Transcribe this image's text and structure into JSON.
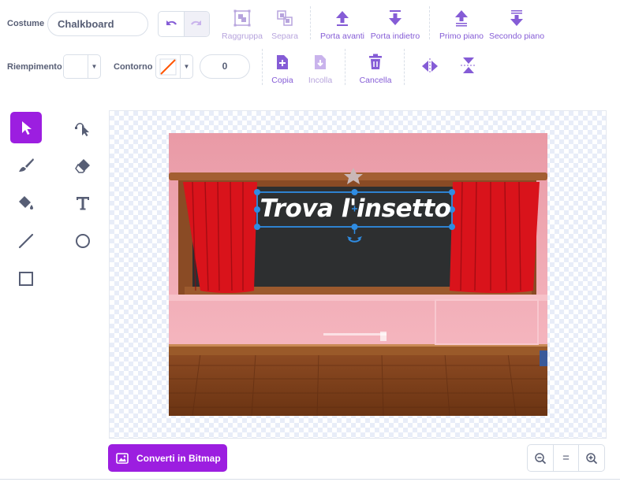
{
  "costume": {
    "label": "Costume",
    "name": "Chalkboard"
  },
  "toolbar": {
    "group": "Raggruppa",
    "ungroup": "Separa",
    "forward": "Porta avanti",
    "backward": "Porta indietro",
    "front": "Primo piano",
    "back": "Secondo piano",
    "copy": "Copia",
    "paste": "Incolla",
    "delete": "Cancella"
  },
  "fill": {
    "label": "Riempimento",
    "color": "#ffffff"
  },
  "outline": {
    "label": "Contorno",
    "width": "0"
  },
  "tools": [
    {
      "name": "select-tool-icon",
      "active": true
    },
    {
      "name": "reshape-tool-icon",
      "active": false
    },
    {
      "name": "brush-tool-icon",
      "active": false
    },
    {
      "name": "eraser-tool-icon",
      "active": false
    },
    {
      "name": "fill-tool-icon",
      "active": false
    },
    {
      "name": "text-tool-icon",
      "active": false
    },
    {
      "name": "line-tool-icon",
      "active": false
    },
    {
      "name": "circle-tool-icon",
      "active": false
    },
    {
      "name": "rectangle-tool-icon",
      "active": false
    }
  ],
  "canvas": {
    "text": "Trova l'insetto"
  },
  "bitmap_button": "Converti in Bitmap",
  "zoom": {
    "reset": "="
  },
  "colors": {
    "accent": "#9c1ee0",
    "accent_light": "#855cd6",
    "selection": "#2f8ce2",
    "curtain": "#d9131b",
    "wall": "#f2a8b2",
    "floor": "#8b4a22"
  }
}
